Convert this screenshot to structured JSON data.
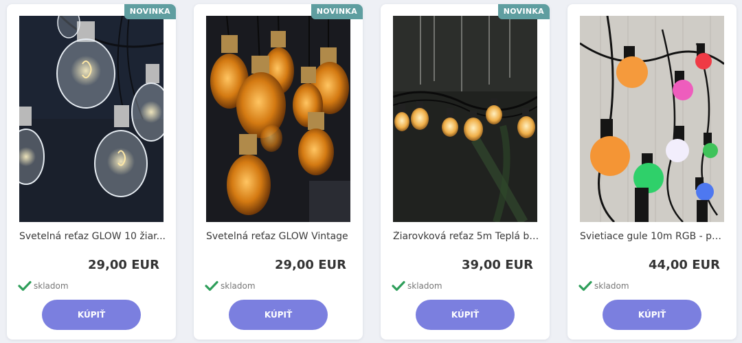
{
  "colors": {
    "badge": "#5f9ea0",
    "button": "#7b7fdf",
    "check": "#2e9e5a",
    "page_bg": "#eef0f5"
  },
  "products": [
    {
      "badge": "NOVINKA",
      "title": "Svetelná reťaz GLOW 10 žiar...",
      "price": "29,00 EUR",
      "stock": "skladom",
      "buy_label": "KÚPIŤ",
      "image_icon": "clear-filament-bulbs-image"
    },
    {
      "badge": "NOVINKA",
      "title": "Svetelná reťaz GLOW Vintage",
      "price": "29,00 EUR",
      "stock": "skladom",
      "buy_label": "KÚPIŤ",
      "image_icon": "amber-vintage-bulbs-image"
    },
    {
      "badge": "NOVINKA",
      "title": "Žiarovková reťaz 5m Teplá bi...",
      "price": "39,00 EUR",
      "stock": "skladom",
      "buy_label": "KÚPIŤ",
      "image_icon": "warm-string-lights-image"
    },
    {
      "title": "Svietiace gule 10m RGB - pár...",
      "price": "44,00 EUR",
      "stock": "skladom",
      "buy_label": "KÚPIŤ",
      "image_icon": "rgb-globe-lights-image"
    }
  ]
}
